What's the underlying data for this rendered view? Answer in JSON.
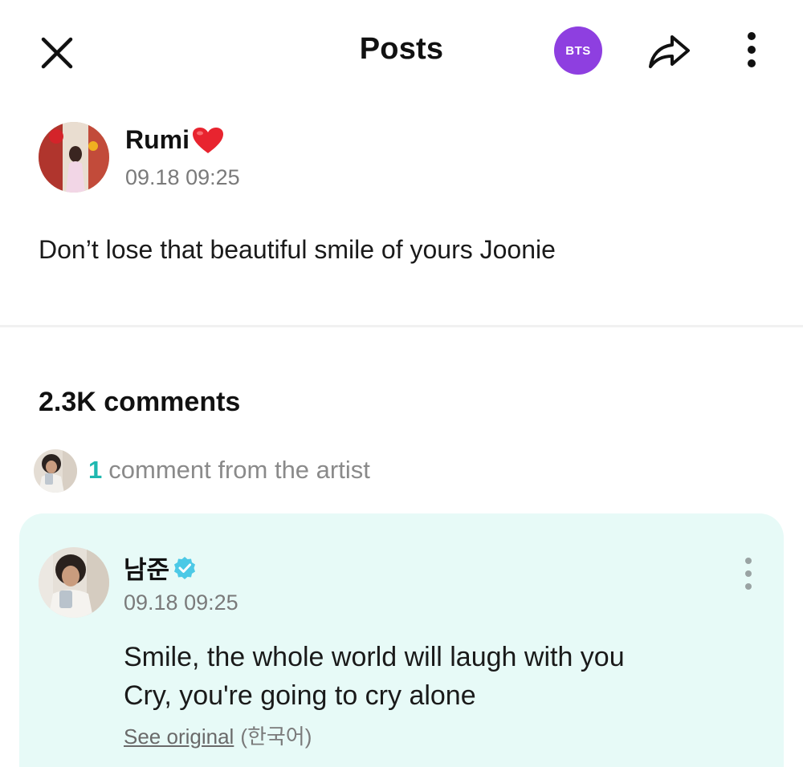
{
  "header": {
    "title": "Posts",
    "community_badge": "BTS",
    "close_icon": "close-icon",
    "share_icon": "share-icon",
    "more_icon": "more-vertical-icon"
  },
  "post": {
    "author_name": "Rumi",
    "author_emoji": "heart-icon",
    "timestamp": "09.18 09:25",
    "body": "Don’t lose that beautiful smile of yours Joonie"
  },
  "comments": {
    "count_label": "2.3K comments",
    "artist_summary": {
      "count": "1",
      "label": "comment from the artist"
    }
  },
  "artist_comment": {
    "author_name": "남준",
    "verified_icon": "verified-badge-icon",
    "timestamp": "09.18 09:25",
    "line1": "Smile, the whole world will laugh with you",
    "line2": "Cry, you're going to cry alone",
    "see_original": "See original",
    "language": "(한국어)"
  },
  "colors": {
    "accent_teal": "#1fb8b0",
    "badge_purple": "#8e3fe0",
    "card_bg": "#e7faf7",
    "verified": "#4cc9e6",
    "heart": "#e8242f"
  }
}
